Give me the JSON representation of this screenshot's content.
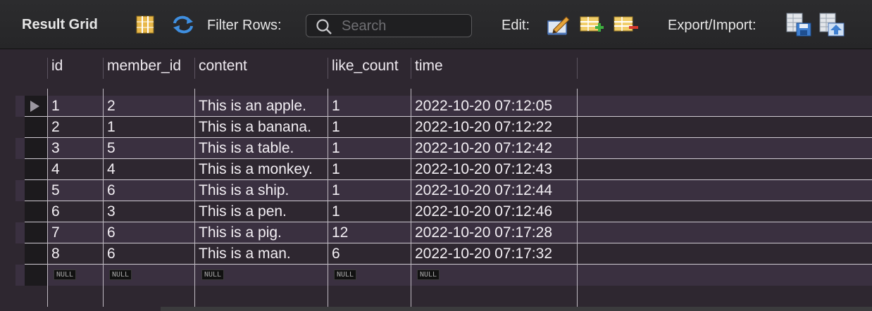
{
  "toolbar": {
    "title": "Result Grid",
    "filter_label": "Filter Rows:",
    "search_placeholder": "Search",
    "edit_label": "Edit:",
    "export_label": "Export/Import:",
    "icons": [
      "grid-toggle-icon",
      "refresh-icon",
      "search-icon",
      "edit-pencil-icon",
      "add-row-icon",
      "delete-row-icon",
      "export-icon",
      "import-icon"
    ]
  },
  "grid": {
    "columns": [
      "id",
      "member_id",
      "content",
      "like_count",
      "time"
    ],
    "rows": [
      [
        "1",
        "2",
        "This is an apple.",
        "1",
        "2022-10-20 07:12:05"
      ],
      [
        "2",
        "1",
        "This is a banana.",
        "1",
        "2022-10-20 07:12:22"
      ],
      [
        "3",
        "5",
        "This is a table.",
        "1",
        "2022-10-20 07:12:42"
      ],
      [
        "4",
        "4",
        "This is a monkey.",
        "1",
        "2022-10-20 07:12:43"
      ],
      [
        "5",
        "6",
        "This is a ship.",
        "1",
        "2022-10-20 07:12:44"
      ],
      [
        "6",
        "3",
        "This is a pen.",
        "1",
        "2022-10-20 07:12:46"
      ],
      [
        "7",
        "6",
        "This is a pig.",
        "12",
        "2022-10-20 07:17:28"
      ],
      [
        "8",
        "6",
        "This is a man.",
        "6",
        "2022-10-20 07:17:32"
      ]
    ],
    "null_label": "NULL"
  }
}
